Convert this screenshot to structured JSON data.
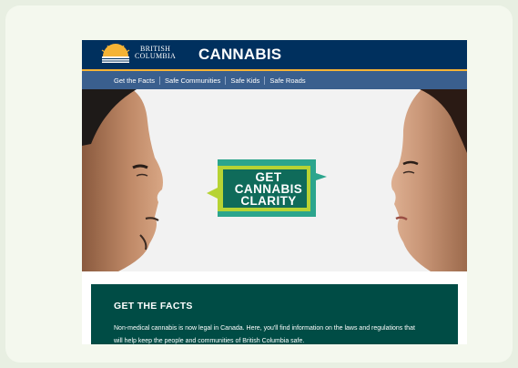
{
  "header": {
    "logo_line1": "BRITISH",
    "logo_line2": "COLUMBIA",
    "site_title": "CANNABIS"
  },
  "nav": {
    "items": [
      "Get the Facts",
      "Safe Communities",
      "Safe Kids",
      "Safe Roads"
    ]
  },
  "hero": {
    "badge_lines": [
      "GET",
      "CANNABIS",
      "CLARITY"
    ]
  },
  "facts": {
    "title": "GET THE FACTS",
    "body_line1": "Non-medical cannabis is now legal in Canada. Here, you'll find information on the laws and regulations that",
    "body_line2": "will help keep the people and communities of British Columbia safe."
  },
  "colors": {
    "header_bg": "#00305e",
    "nav_bg": "#3a5f8e",
    "gold": "#f5b335",
    "badge_green": "#2ca58d",
    "badge_lime": "#b7d334",
    "facts_bg": "#004c45"
  }
}
